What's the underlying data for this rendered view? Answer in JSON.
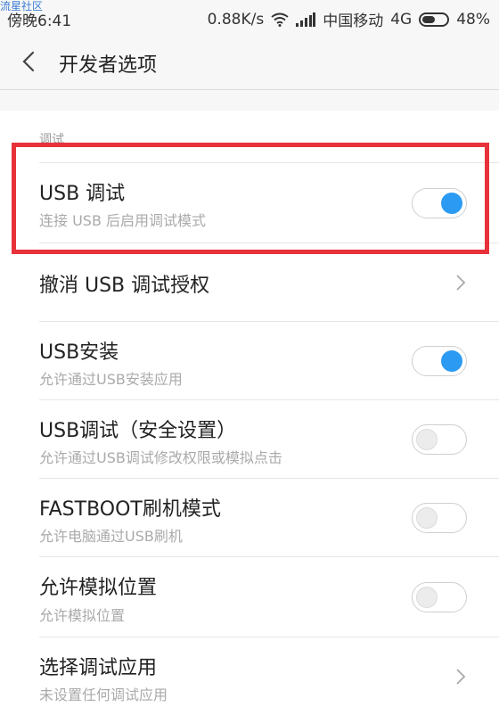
{
  "watermark": "流星社区",
  "status_bar": {
    "time": "傍晚6:41",
    "speed": "0.88K/s",
    "carrier": "中国移动",
    "network": "4G",
    "battery": "48%",
    "icons": [
      "wifi-icon",
      "signal-icon",
      "battery-icon"
    ]
  },
  "header": {
    "title": "开发者选项",
    "back_icon": "chevron-left-icon"
  },
  "section": {
    "label": "调试"
  },
  "settings": [
    {
      "label": "USB 调试",
      "subtitle": "连接 USB 后启用调试模式",
      "control": "toggle",
      "enabled": true
    },
    {
      "label": "撤消 USB 调试授权",
      "subtitle": "",
      "control": "chevron"
    },
    {
      "label": "USB安装",
      "subtitle": "允许通过USB安装应用",
      "control": "toggle",
      "enabled": true
    },
    {
      "label": "USB调试（安全设置）",
      "subtitle": "允许通过USB调试修改权限或模拟点击",
      "control": "toggle",
      "enabled": false
    },
    {
      "label": "FASTBOOT刷机模式",
      "subtitle": "允许电脑通过USB刷机",
      "control": "toggle",
      "enabled": false
    },
    {
      "label": "允许模拟位置",
      "subtitle": "允许模拟位置",
      "control": "toggle",
      "enabled": false
    },
    {
      "label": "选择调试应用",
      "subtitle": "未设置任何调试应用",
      "control": "chevron"
    }
  ],
  "colors": {
    "accent": "#2b9af3",
    "highlight_border": "#e8323a",
    "background": "#f7f7f7"
  }
}
